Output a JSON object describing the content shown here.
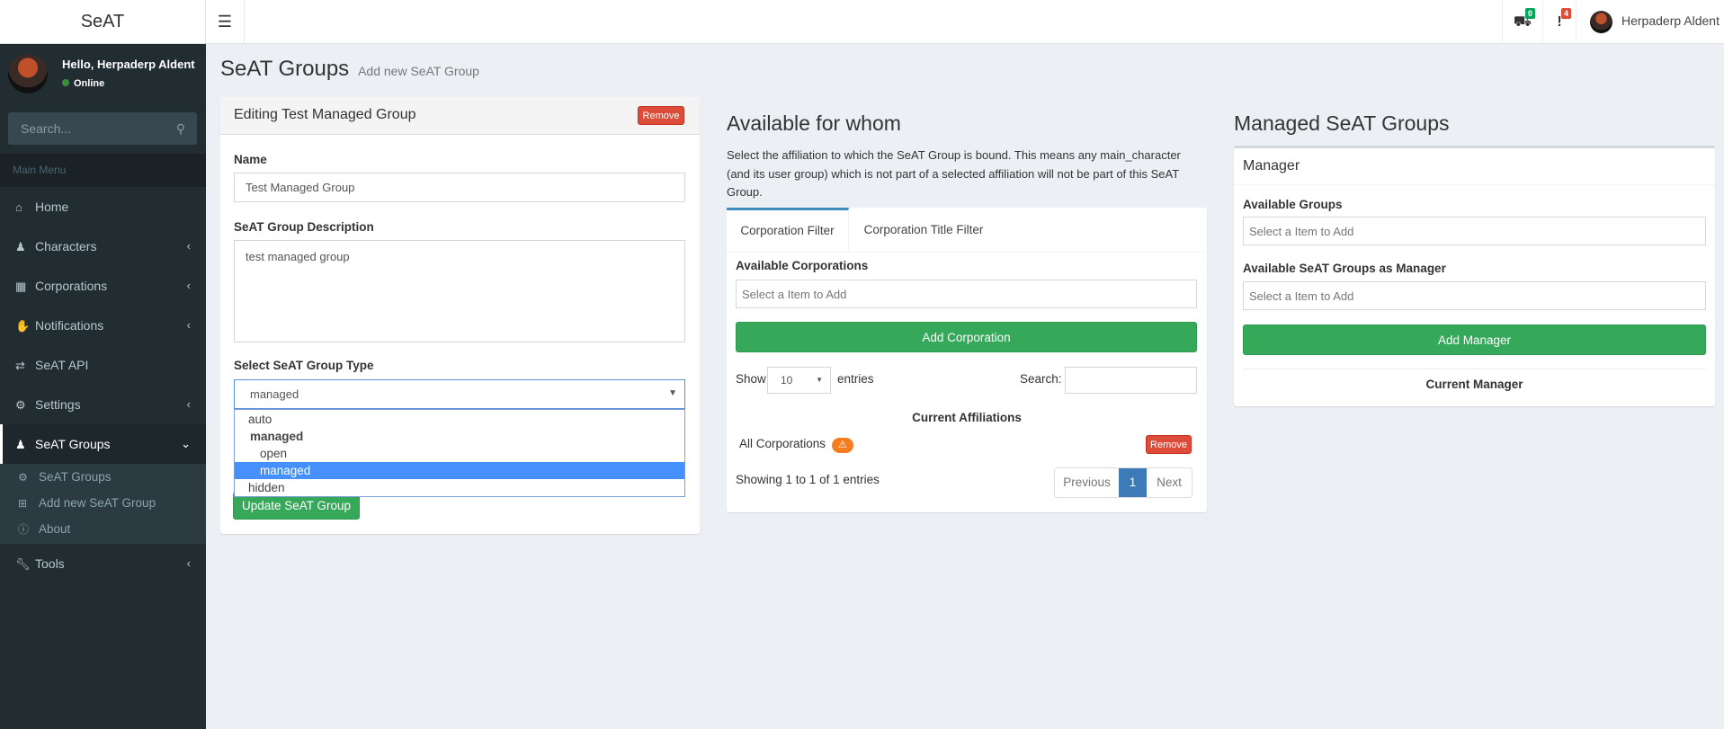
{
  "header": {
    "logo": "SeAT",
    "menu_icon": "bars-icon",
    "notifications": [
      {
        "icon": "truck-icon",
        "count": "0",
        "color": "#00a65a"
      },
      {
        "icon": "exclamation-icon",
        "count": "4",
        "color": "#dd4b39"
      }
    ],
    "user_name": "Herpaderp Aldent"
  },
  "sidebar": {
    "greeting": "Hello, Herpaderp Aldent",
    "status": "Online",
    "search_placeholder": "Search...",
    "menu_header": "Main Menu",
    "items": [
      {
        "label": "Home",
        "icon": "home-icon"
      },
      {
        "label": "Characters",
        "icon": "user-icon"
      },
      {
        "label": "Corporations",
        "icon": "building-icon"
      },
      {
        "label": "Notifications",
        "icon": "hand-icon"
      },
      {
        "label": "SeAT API",
        "icon": "exchange-icon"
      },
      {
        "label": "Settings",
        "icon": "cogs-icon"
      },
      {
        "label": "SeAT Groups",
        "icon": "users-icon",
        "active": true
      },
      {
        "label": "Tools",
        "icon": "wrench-icon"
      }
    ],
    "subitems": [
      {
        "label": "SeAT Groups",
        "icon": "gear-icon"
      },
      {
        "label": "Add new SeAT Group",
        "icon": "plus-square-icon"
      },
      {
        "label": "About",
        "icon": "info-icon"
      }
    ]
  },
  "page": {
    "title": "SeAT Groups",
    "subtitle": "Add new SeAT Group"
  },
  "edit_box": {
    "title": "Editing Test Managed Group",
    "remove": "Remove",
    "name_label": "Name",
    "name_value": "Test Managed Group",
    "description_label": "SeAT Group Description",
    "description_value": "test managed group",
    "type_label": "Select SeAT Group Type",
    "type_value": "managed",
    "options": {
      "auto": "auto",
      "group_label": "managed",
      "open": "open",
      "managed": "managed",
      "hidden": "hidden"
    },
    "update": "Update SeAT Group"
  },
  "affiliation": {
    "title": "Available for whom",
    "description": "Select the affiliation to which the SeAT Group is bound. This means any main_character (and its user group) which is not part of a selected affiliation will not be part of this SeAT Group.",
    "tabs": [
      "Corporation Filter",
      "Corporation Title Filter"
    ],
    "corp_label": "Available Corporations",
    "corp_placeholder": "Select a Item to Add",
    "add_button": "Add Corporation",
    "show": "Show",
    "entries_value": "10",
    "entries": "entries",
    "search_label": "Search:",
    "table_header": "Current Affiliations",
    "rows": [
      {
        "name": "All Corporations",
        "remove": "Remove"
      }
    ],
    "showing": "Showing 1 to 1 of 1 entries",
    "pagination": {
      "previous": "Previous",
      "page": "1",
      "next": "Next"
    }
  },
  "managed": {
    "title": "Managed SeAT Groups",
    "box_title": "Manager",
    "groups_label": "Available Groups",
    "groups_placeholder": "Select a Item to Add",
    "managers_label": "Available SeAT Groups as Manager",
    "managers_placeholder": "Select a Item to Add",
    "add_button": "Add Manager",
    "current_label": "Current Manager"
  }
}
